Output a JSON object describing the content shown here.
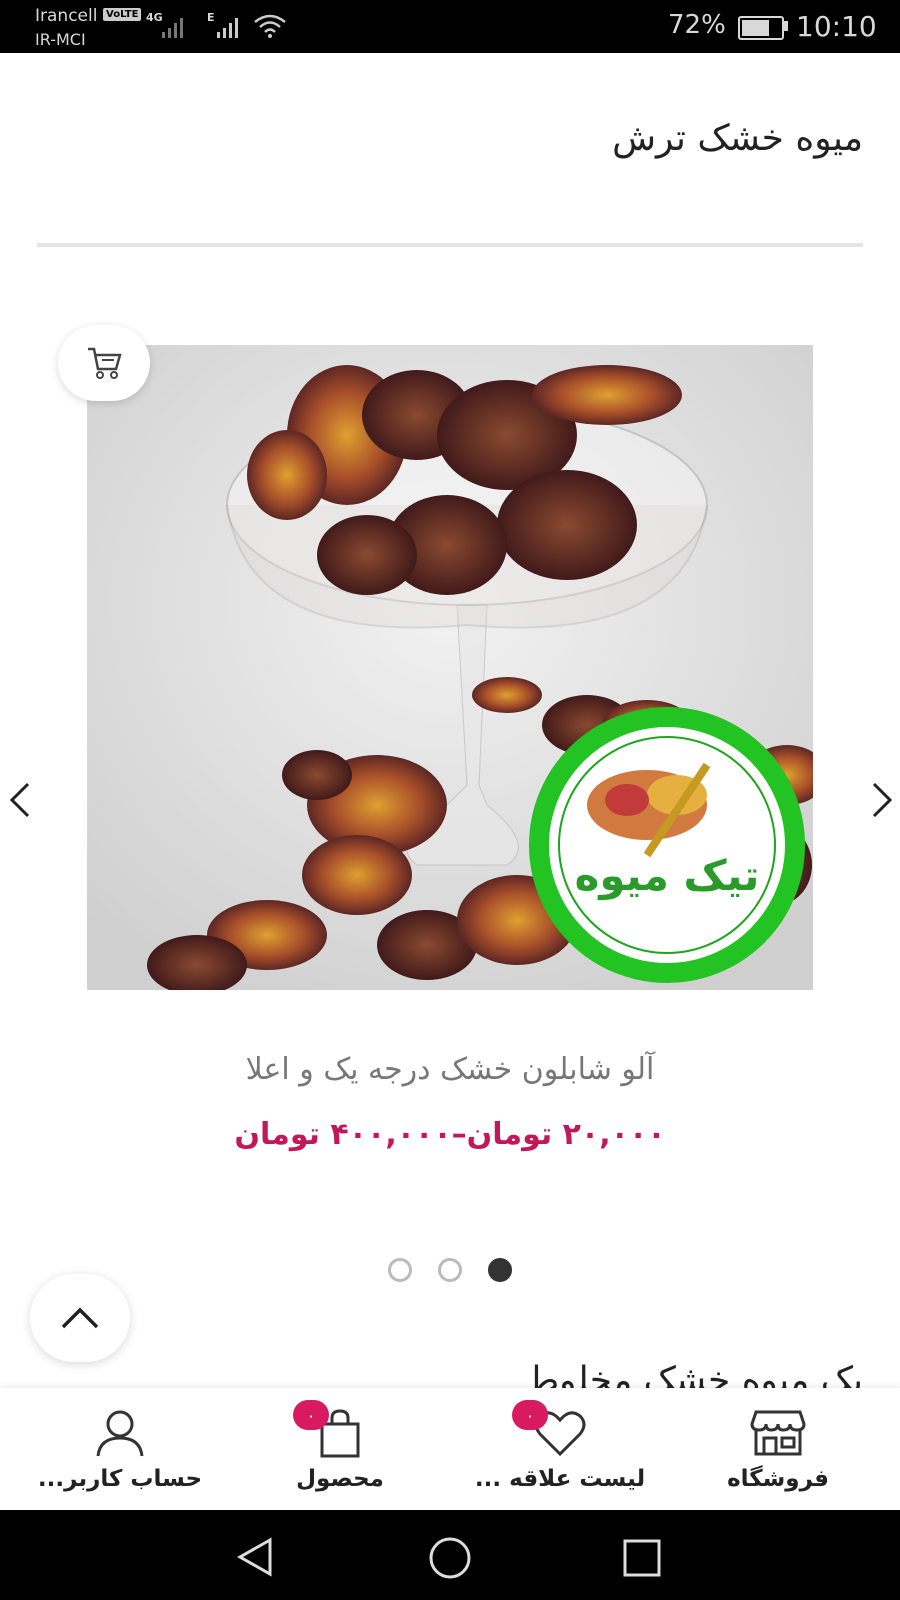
{
  "status_bar": {
    "carrier_1": "Irancell",
    "volte_badge": "VoLTE",
    "network_4g": "4G",
    "network_e": "E",
    "carrier_2": "IR-MCI",
    "battery_percent": "72%",
    "battery_level": 0.72,
    "time": "10:10"
  },
  "section": {
    "title": "میوه خشک ترش"
  },
  "product": {
    "name": "آلو شابلون خشک درجه یک و اعلا",
    "price": "۲۰,۰۰۰ تومان–۴۰۰,۰۰۰ تومان",
    "image_icon": "dried-plum-image"
  },
  "carousel": {
    "dot_count": 3,
    "active_dot": 3,
    "prev_icon": "chevron-left-icon",
    "next_icon": "chevron-right-icon"
  },
  "next_section": {
    "title": "یک میوه خشک مخلوط"
  },
  "bottom_nav": {
    "items": [
      {
        "label": "حساب کاربر...",
        "icon": "user-icon"
      },
      {
        "label": "محصول",
        "icon": "shopping-bag-icon",
        "badge": "۰"
      },
      {
        "label": "لیست علاقه ...",
        "icon": "heart-icon",
        "badge": "۰"
      },
      {
        "label": "فروشگاه",
        "icon": "store-icon"
      }
    ]
  },
  "colors": {
    "accent": "#c2185b",
    "badge": "#d81b60",
    "status_bar": "#000000"
  }
}
